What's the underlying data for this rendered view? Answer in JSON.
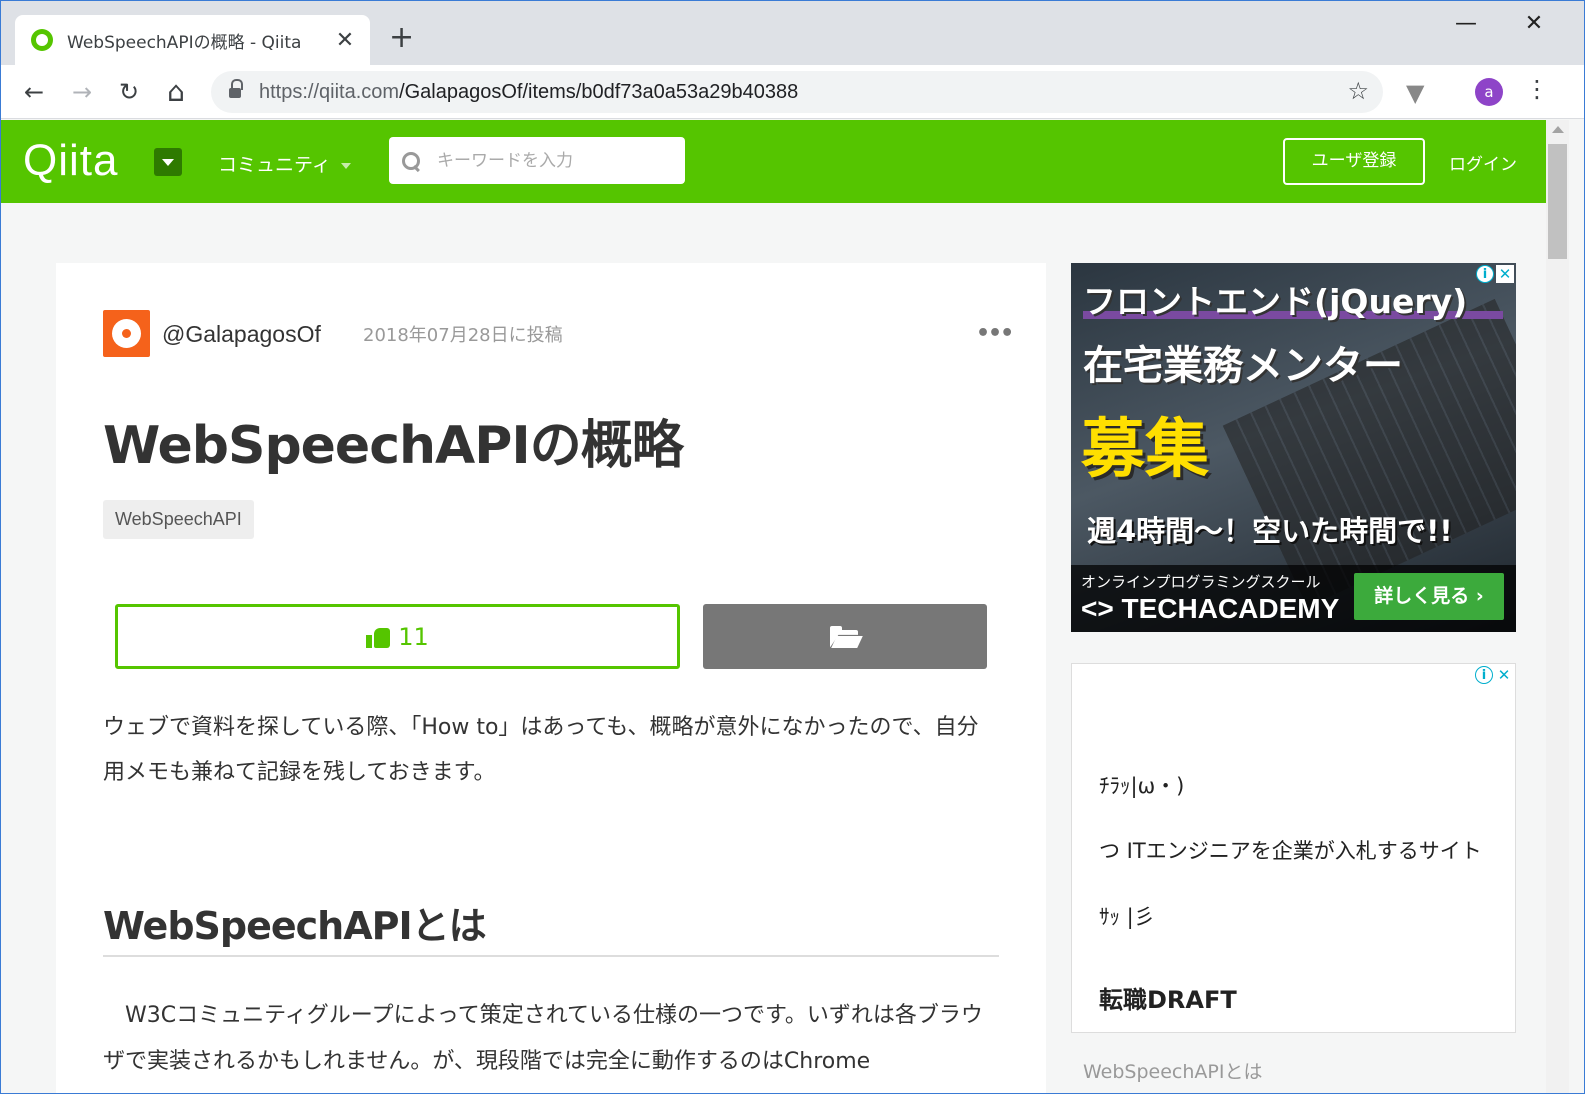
{
  "browser": {
    "tab_title": "WebSpeechAPIの概略 - Qiita",
    "tab_close": "✕",
    "new_tab": "+",
    "window_controls": {
      "minimize": "—",
      "maximize": "☐",
      "close": "✕"
    },
    "nav": {
      "back": "←",
      "forward": "→",
      "reload": "↻",
      "home": "⌂"
    },
    "url_host": "https://qiita.com",
    "url_path": "/GalapagosOf/items/b0df73a0a53a29b40388",
    "star": "☆",
    "ext": "▼",
    "profile_initial": "a",
    "menu": "⋮"
  },
  "header": {
    "logo": "Qiita",
    "community": "コミュニティ",
    "search_placeholder": "キーワードを入力",
    "signup": "ユーザ登録",
    "login": "ログイン"
  },
  "article": {
    "author": "@GalapagosOf",
    "date": "2018年07月28日に投稿",
    "more": "•••",
    "title": "WebSpeechAPIの概略",
    "tag": "WebSpeechAPI",
    "likes": "11",
    "intro": "ウェブで資料を探している際、「How to」はあっても、概略が意外になかったので、自分用メモも兼ねて記録を残しておきます。",
    "section_heading": "WebSpeechAPIとは",
    "section_body": "W3Cコミュニティグループによって策定されている仕様の一つです。いずれは各ブラウザで実装されるかもしれません。が、現段階では完全に動作するのはChrome"
  },
  "ads": {
    "info": "i",
    "close": "✕",
    "ad1": {
      "line1": "フロントエンド(jQuery)",
      "line2": "在宅業務メンター",
      "line3": "募集",
      "line4": "週4時間〜！空いた時間で!!",
      "school": "オンラインプログラミングスクール",
      "brand": "<> TECHACADEMY",
      "cta": "詳しく見る ›"
    },
    "ad2": {
      "line1": "ﾁﾗｯ|ω・)",
      "line2": "つ ITエンジニアを企業が入札するサイト",
      "line3": "ｻｯ |彡",
      "brand": "転職DRAFT"
    }
  },
  "sidebar": {
    "toc_item": "WebSpeechAPIとは"
  }
}
